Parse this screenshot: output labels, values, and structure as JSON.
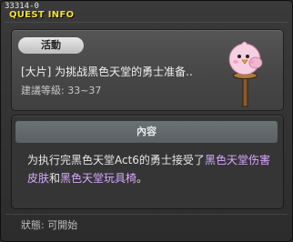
{
  "window": {
    "quest_id": "33314-0",
    "title": "QUEST INFO"
  },
  "quest": {
    "badge": "活動",
    "name": "[大片] 为挑战黑色天堂的勇士准备..",
    "level_label": "建議等級: 33~37"
  },
  "content": {
    "header": "內容",
    "text_1": "为执行完黑色天堂Act6的勇士接受了",
    "highlight_1": "黑色天堂伤害皮肤",
    "text_2": "和",
    "highlight_2": "黑色天堂玩具椅",
    "text_3": "。"
  },
  "status": "狀態:  可開始",
  "colors": {
    "title_yellow": "#f2e030",
    "highlight_purple": "#d7a8ff",
    "header_slate": "#626a6d"
  },
  "icons": {
    "npc": "pink-bird-on-signpost"
  }
}
